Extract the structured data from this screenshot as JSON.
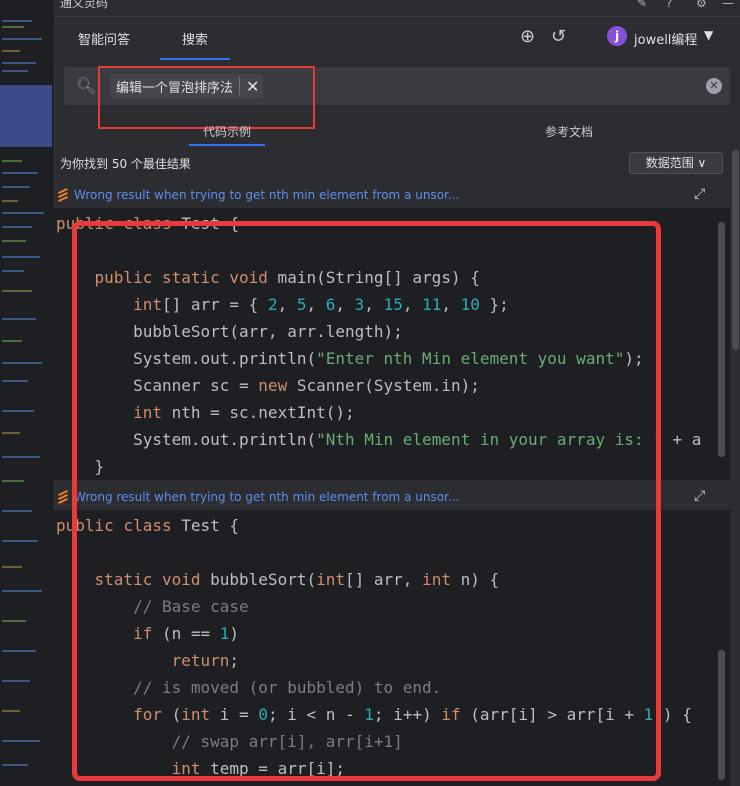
{
  "window": {
    "title": "通义灵码"
  },
  "header": {
    "tabs": [
      {
        "label": "智能问答",
        "active": false
      },
      {
        "label": "搜索",
        "active": true
      }
    ],
    "user": {
      "avatar_letter": "j",
      "name": "jowell编程"
    }
  },
  "search": {
    "query": "编辑一个冒泡排序法"
  },
  "subtabs": [
    {
      "label": "代码示例",
      "active": true
    },
    {
      "label": "参考文档",
      "active": false
    }
  ],
  "results_info": "为你找到 50 个最佳结果",
  "range_button": "数据范围",
  "results": [
    {
      "title": "Wrong result when trying to get nth min element from a unsor..."
    },
    {
      "title": "Wrong result when trying to get nth min element from a unsor..."
    }
  ],
  "colors": {
    "accent": "#3574f0",
    "highlight_box": "#e83a3a",
    "keyword": "#cf8e6d",
    "number": "#2aacb8",
    "string": "#6aab73",
    "comment": "#7a7e85"
  },
  "icons": [
    "search-icon",
    "close-icon",
    "clear-icon",
    "add-icon",
    "history-icon",
    "chevron-down-icon",
    "expand-icon",
    "stackoverflow-icon",
    "edit-icon",
    "help-icon",
    "gear-icon"
  ]
}
